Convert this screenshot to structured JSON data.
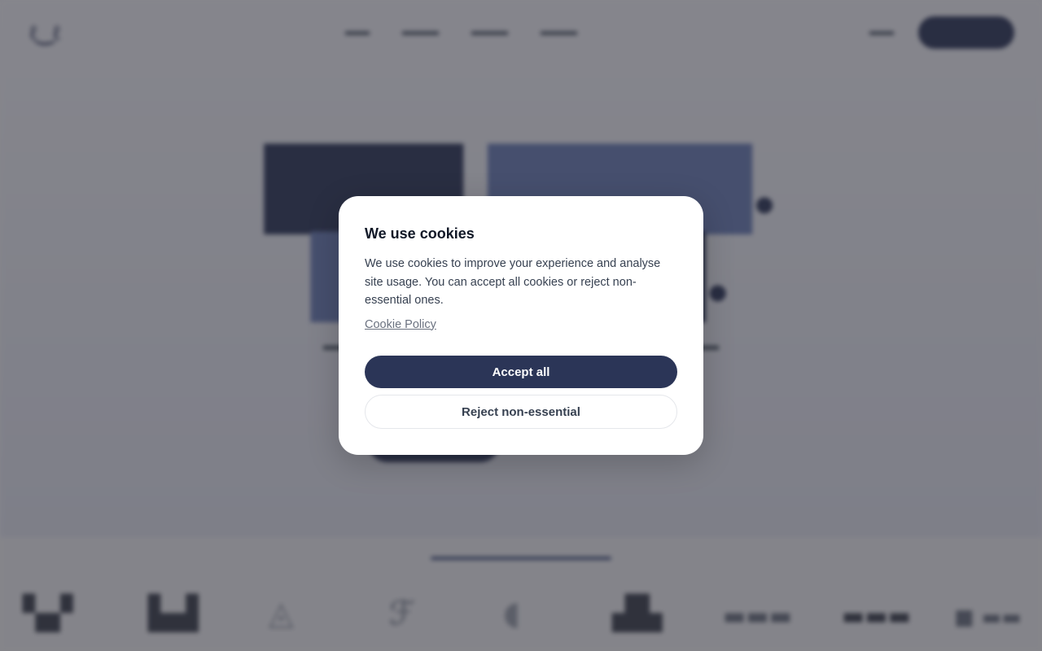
{
  "cookie_modal": {
    "title": "We use cookies",
    "body": "We use cookies to improve your experience and analyse site usage. You can accept all cookies or reject non-essential ones.",
    "policy_link": "Cookie Policy",
    "accept_label": "Accept all",
    "reject_label": "Reject non-essential"
  },
  "colors": {
    "primary": "#2b3557",
    "overlay": "rgba(40,40,50,0.55)",
    "modal_bg": "#ffffff"
  }
}
